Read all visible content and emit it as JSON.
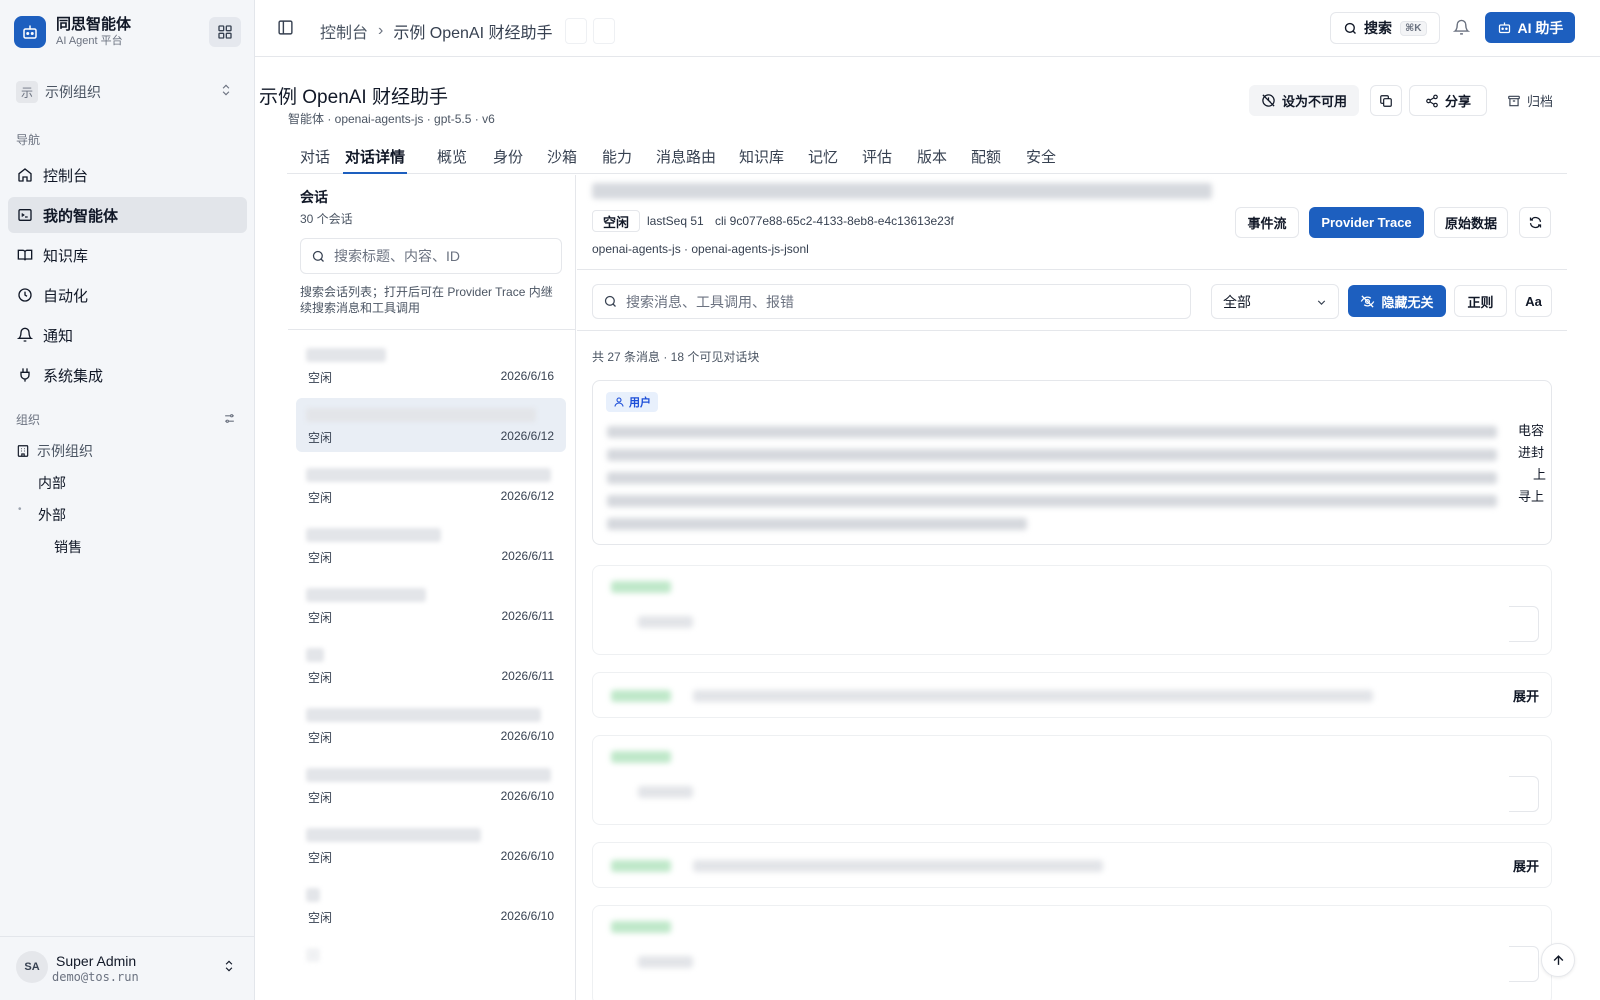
{
  "app": {
    "name": "同思智能体",
    "subtitle": "AI Agent 平台"
  },
  "org_switcher": {
    "avatar": "示",
    "name": "示例组织"
  },
  "nav": {
    "section_label": "导航",
    "items": [
      {
        "label": "控制台",
        "icon": "home-icon"
      },
      {
        "label": "我的智能体",
        "icon": "terminal-icon",
        "active": true
      },
      {
        "label": "知识库",
        "icon": "book-icon"
      },
      {
        "label": "自动化",
        "icon": "clock-icon"
      },
      {
        "label": "通知",
        "icon": "bell-icon"
      },
      {
        "label": "系统集成",
        "icon": "plug-icon"
      }
    ]
  },
  "org_section": {
    "label": "组织",
    "root": "示例组织",
    "children": [
      "内部",
      "外部",
      "销售"
    ]
  },
  "user": {
    "initials": "SA",
    "name": "Super Admin",
    "email": "demo@tos.run"
  },
  "topbar": {
    "breadcrumb_root": "控制台",
    "breadcrumb_current": "示例 OpenAI 财经助手",
    "search_label": "搜索",
    "search_kbd": "⌘K",
    "ai_button": "AI 助手"
  },
  "agent": {
    "title": "示例 OpenAI 财经助手",
    "meta": "智能体 · openai-agents-js · gpt-5.5 · v6",
    "actions": {
      "disable": "设为不可用",
      "share": "分享",
      "archive": "归档"
    }
  },
  "tabs": [
    "对话",
    "对话详情",
    "概览",
    "身份",
    "沙箱",
    "能力",
    "消息路由",
    "知识库",
    "记忆",
    "评估",
    "版本",
    "配额",
    "安全"
  ],
  "active_tab": "对话详情",
  "sessions": {
    "title": "会话",
    "count": "30 个会话",
    "search_placeholder": "搜索标题、内容、ID",
    "hint": "搜索会话列表；打开后可在 Provider Trace 内继续搜索消息和工具调用",
    "rows": [
      {
        "status": "空闲",
        "date": "2026/6/16"
      },
      {
        "status": "空闲",
        "date": "2026/6/12"
      },
      {
        "status": "空闲",
        "date": "2026/6/12"
      },
      {
        "status": "空闲",
        "date": "2026/6/11"
      },
      {
        "status": "空闲",
        "date": "2026/6/11"
      },
      {
        "status": "空闲",
        "date": "2026/6/11"
      },
      {
        "status": "空闲",
        "date": "2026/6/10"
      },
      {
        "status": "空闲",
        "date": "2026/6/10"
      },
      {
        "status": "空闲",
        "date": "2026/6/10"
      },
      {
        "status": "空闲",
        "date": "2026/6/10"
      }
    ]
  },
  "detail": {
    "status_badge": "空闲",
    "last_seq": "lastSeq 51",
    "cli": "cli 9c077e88-65c2-4133-8eb8-e4c13613e23f",
    "sdk": "openai-agents-js · openai-agents-js-jsonl",
    "buttons": {
      "event_stream": "事件流",
      "provider_trace": "Provider Trace",
      "raw_data": "原始数据"
    },
    "search_placeholder": "搜索消息、工具调用、报错",
    "filter_value": "全部",
    "hide_irrelevant": "隐藏无关",
    "regex": "正则",
    "case": "Aa",
    "summary": "共 27 条消息 · 18 个可见对话块",
    "user_role": "用户",
    "peek_chars": [
      "电容",
      "进封",
      "上",
      "寻上"
    ],
    "expand_label": "展开"
  },
  "colors": {
    "accent": "#1d5fbf",
    "sidebar_bg": "#f4f6f9",
    "selected_row": "#e9eef5"
  }
}
